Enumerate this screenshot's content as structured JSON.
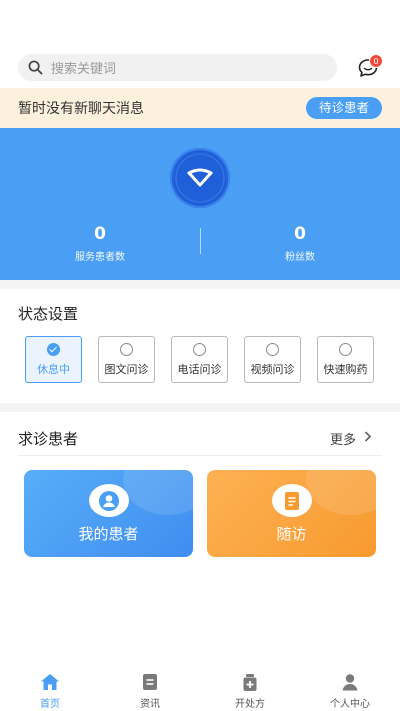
{
  "search": {
    "placeholder": "搜索关键词"
  },
  "messages": {
    "badge_count": "0"
  },
  "notice": {
    "text": "暂时没有新聊天消息",
    "button": "待诊患者"
  },
  "stats": [
    {
      "value": "0",
      "label": "服务患者数"
    },
    {
      "value": "0",
      "label": "粉丝数"
    }
  ],
  "status_settings": {
    "title": "状态设置",
    "options": [
      {
        "label": "休息中",
        "selected": true
      },
      {
        "label": "图文问诊",
        "selected": false
      },
      {
        "label": "电话问诊",
        "selected": false
      },
      {
        "label": "视频问诊",
        "selected": false
      },
      {
        "label": "快速购药",
        "selected": false
      }
    ]
  },
  "patients": {
    "title": "求诊患者",
    "more": "更多",
    "cards": [
      {
        "label": "我的患者",
        "icon": "user-icon"
      },
      {
        "label": "随访",
        "icon": "document-icon"
      }
    ]
  },
  "tabs": [
    {
      "label": "首页",
      "icon": "home-icon",
      "active": true
    },
    {
      "label": "资讯",
      "icon": "news-icon",
      "active": false
    },
    {
      "label": "开处方",
      "icon": "prescription-icon",
      "active": false
    },
    {
      "label": "个人中心",
      "icon": "person-icon",
      "active": false
    }
  ],
  "colors": {
    "accent": "#4a9ef4",
    "notice_bg": "#fdf1dd",
    "orange": "#f79a2f",
    "badge": "#f04b3a"
  }
}
